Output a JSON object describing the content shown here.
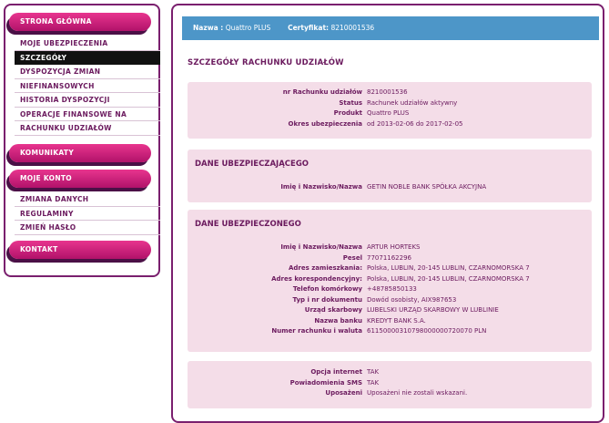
{
  "sidebar": {
    "menu_home": "STRONA GŁÓWNA",
    "sub1": [
      {
        "label": "MOJE UBEZPIECZENIA"
      },
      {
        "label": "SZCZEGÓŁY"
      },
      {
        "label": "DYSPOZYCJA ZMIAN"
      },
      {
        "label": "NIEFINANSOWYCH"
      },
      {
        "label": "HISTORIA DYSPOZYCJI"
      },
      {
        "label": "OPERACJE FINANSOWE NA"
      },
      {
        "label": "RACHUNKU UDZIAŁÓW"
      }
    ],
    "menu_comms": "KOMUNIKATY",
    "menu_account": "MOJE KONTO",
    "sub2": [
      {
        "label": "ZMIANA DANYCH"
      },
      {
        "label": "REGULAMINY"
      },
      {
        "label": "ZMIEŃ HASŁO"
      }
    ],
    "menu_contact": "KONTAKT"
  },
  "topbar": {
    "name_label": "Nazwa :",
    "name_value": "Quattro PLUS",
    "cert_label": "Certyfikat:",
    "cert_value": "8210001536"
  },
  "page_title": "SZCZEGÓŁY RACHUNKU UDZIAŁÓW",
  "account": {
    "rows": [
      {
        "k": "nr Rachunku udziałów",
        "v": "8210001536"
      },
      {
        "k": "Status",
        "v": "Rachunek udziałów aktywny"
      },
      {
        "k": "Produkt",
        "v": "Quattro PLUS"
      },
      {
        "k": "Okres ubezpieczenia",
        "v": "od 2013-02-06 do 2017-02-05"
      }
    ]
  },
  "insurer": {
    "title": "DANE UBEZPIECZAJĄCEGO",
    "rows": [
      {
        "k": "Imię i Nazwisko/Nazwa",
        "v": "GETIN NOBLE BANK SPÓŁKA AKCYJNA"
      }
    ]
  },
  "insured": {
    "title": "DANE UBEZPIECZONEGO",
    "rows": [
      {
        "k": "Imię i Nazwisko/Nazwa",
        "v": "ARTUR HORTEKS"
      },
      {
        "k": "Pesel",
        "v": "77071162296"
      },
      {
        "k": "Adres zamieszkania:",
        "v": "Polska, LUBLIN, 20-145 LUBLIN, CZARNOMORSKA 7"
      },
      {
        "k": "Adres korespondencyjny:",
        "v": "Polska, LUBLIN, 20-145 LUBLIN, CZARNOMORSKA 7"
      },
      {
        "k": "Telefon komórkowy",
        "v": "+48785850133"
      },
      {
        "k": "Typ i nr dokumentu",
        "v": "Dowód osobisty, AIX987653"
      },
      {
        "k": "Urząd skarbowy",
        "v": "LUBELSKI URZĄD SKARBOWY W LUBLINIE"
      },
      {
        "k": "Nazwa banku",
        "v": "KREDYT BANK S.A."
      },
      {
        "k": "Numer rachunku i waluta",
        "v": "61150000310798000000720070 PLN"
      }
    ]
  },
  "options": {
    "rows": [
      {
        "k": "Opcja internet",
        "v": "TAK"
      },
      {
        "k": "Powiadomienia SMS",
        "v": "TAK"
      },
      {
        "k": "Uposażeni",
        "v": "Uposażeni nie zostali wskazani."
      }
    ]
  }
}
